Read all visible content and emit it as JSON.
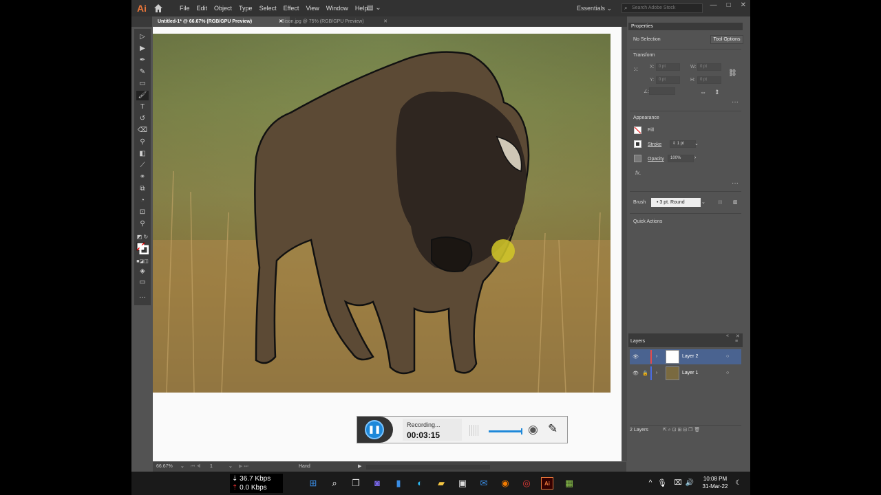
{
  "app": {
    "logo": "Ai"
  },
  "menu": [
    "File",
    "Edit",
    "Object",
    "Type",
    "Select",
    "Effect",
    "View",
    "Window",
    "Help"
  ],
  "workspace": "Essentials",
  "search": {
    "placeholder": "Search Adobe Stock"
  },
  "tabs": [
    {
      "label": "Untitled-1* @ 66.67% (RGB/GPU Preview)"
    },
    {
      "label": "Bison.jpg @ 75% (RGB/GPU Preview)"
    }
  ],
  "properties": {
    "title": "Properties",
    "selection": "No Selection",
    "tool_options": "Tool Options",
    "transform": "Transform",
    "x_label": "X:",
    "x_value": "0 pt",
    "w_label": "W:",
    "w_value": "0 pt",
    "y_label": "Y:",
    "y_value": "0 pt",
    "h_label": "H:",
    "h_value": "0 pt",
    "angle_label": "∠:",
    "appearance": "Appearance",
    "fill": "Fill",
    "stroke": "Stroke",
    "stroke_weight": "1 pt",
    "opacity": "Opacity",
    "opacity_value": "100%",
    "fx": "fx.",
    "brush": "Brush",
    "brush_value": "3 pt. Round",
    "quick_actions": "Quick Actions"
  },
  "layers": {
    "title": "Layers",
    "items": [
      {
        "name": "Layer 2",
        "color": "#e64b4b",
        "selected": true
      },
      {
        "name": "Layer 1",
        "color": "#4b6ee6",
        "selected": false
      }
    ],
    "count": "2 Layers"
  },
  "status": {
    "zoom": "66.67%",
    "artboard": "1",
    "tool": "Hand"
  },
  "recorder": {
    "label": "Recording...",
    "time": "00:03:15"
  },
  "network": {
    "down": "36.7 Kbps",
    "up": "0.0 Kbps"
  },
  "clock": {
    "time": "10:08 PM",
    "date": "31-Mar-22"
  }
}
